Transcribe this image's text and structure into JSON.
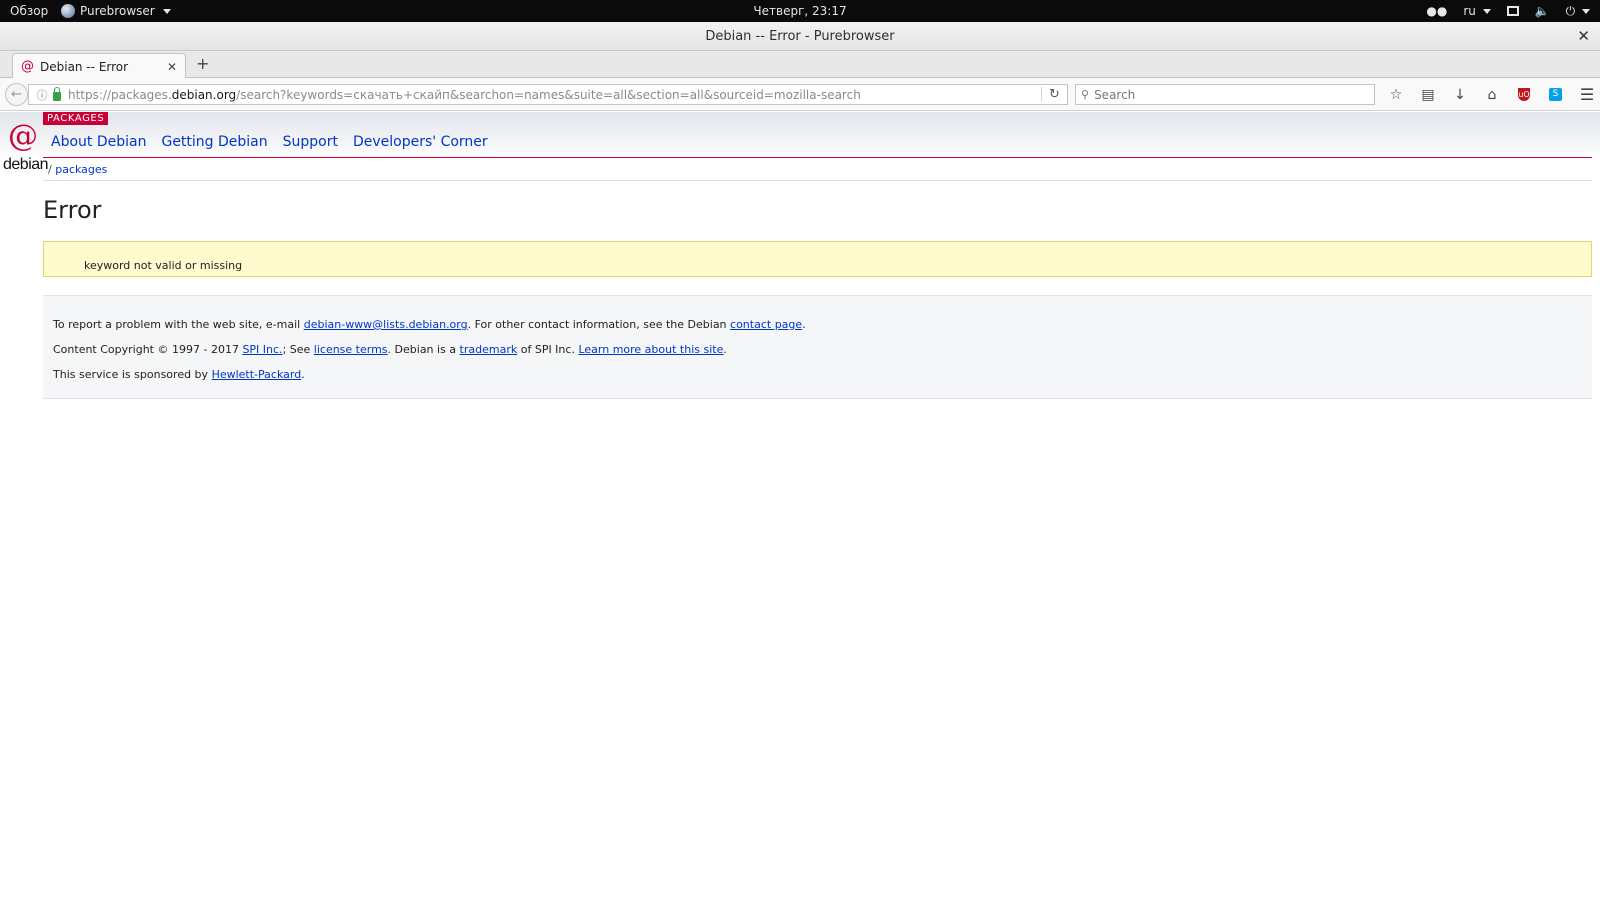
{
  "system_bar": {
    "overview": "Обзор",
    "app_name": "Purebrowser",
    "clock": "Четверг, 23:17",
    "language": "ru"
  },
  "window": {
    "title": "Debian -- Error - Purebrowser",
    "close_glyph": "✕"
  },
  "tabs": [
    {
      "label": "Debian -- Error",
      "close_glyph": "✕"
    }
  ],
  "new_tab_glyph": "+",
  "toolbar": {
    "url_prefix": "https://packages.",
    "url_domain": "debian.org",
    "url_rest": "/search?keywords=скачать+скайп&searchon=names&suite=all&section=all&sourceid=mozilla-search",
    "search_placeholder": "Search",
    "icons": [
      "back-icon",
      "info-icon",
      "lock-icon",
      "reload-icon",
      "search-icon",
      "bookmark-star-icon",
      "reading-list-icon",
      "download-icon",
      "home-icon",
      "ublock-icon",
      "skype-icon",
      "hamburger-menu-icon"
    ]
  },
  "site": {
    "section_badge": "PACKAGES",
    "logo_text": "debian",
    "nav": [
      "About Debian",
      "Getting Debian",
      "Support",
      "Developers' Corner"
    ],
    "breadcrumb_sep": "/",
    "breadcrumb_link": "packages"
  },
  "content": {
    "title": "Error",
    "message": "keyword not valid or missing"
  },
  "footer": {
    "line1_a": "To report a problem with the web site, e-mail ",
    "line1_email": "debian-www@lists.debian.org",
    "line1_b": ". For other contact information, see the Debian ",
    "line1_contact": "contact page",
    "line1_c": ".",
    "line2_a": "Content Copyright © 1997 - 2017 ",
    "line2_spi": "SPI Inc.",
    "line2_b": "; See ",
    "line2_license": "license terms",
    "line2_c": ". Debian is a ",
    "line2_trademark": "trademark",
    "line2_d": " of SPI Inc. ",
    "line2_learn": "Learn more about this site",
    "line2_e": ".",
    "line3_a": "This service is sponsored by ",
    "line3_hp": "Hewlett-Packard",
    "line3_b": "."
  },
  "colors": {
    "debian_red": "#c70036",
    "link_blue": "#0035c7",
    "error_bg": "#fffbce"
  }
}
